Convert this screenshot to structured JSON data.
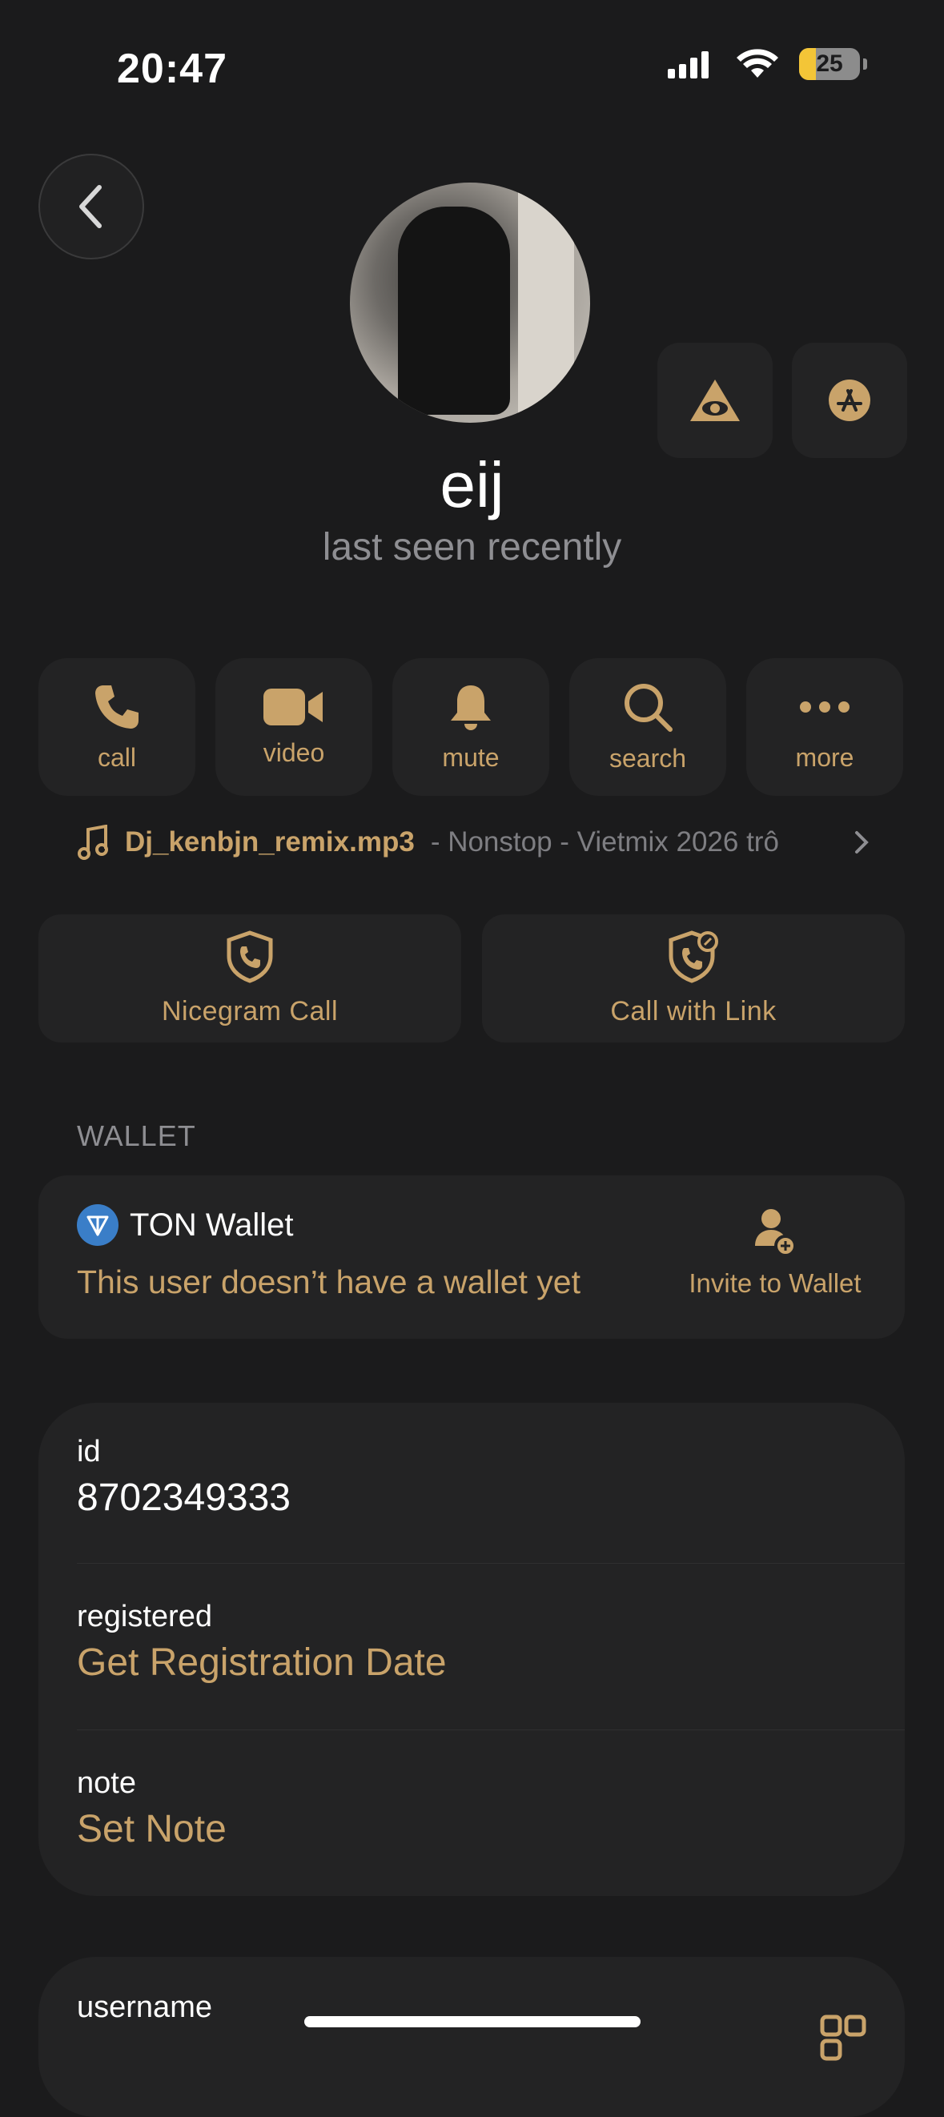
{
  "status_bar": {
    "time": "20:47",
    "battery": "25"
  },
  "profile": {
    "name": "eij",
    "status": "last seen recently"
  },
  "actions": [
    {
      "label": "call",
      "icon": "phone-icon"
    },
    {
      "label": "video",
      "icon": "video-camera-icon"
    },
    {
      "label": "mute",
      "icon": "bell-icon"
    },
    {
      "label": "search",
      "icon": "search-icon"
    },
    {
      "label": "more",
      "icon": "ellipsis-icon"
    }
  ],
  "music": {
    "song": "Dj_kenbjn_remix.mp3",
    "rest": " - Nonstop - Vietmix 2026 trô"
  },
  "calls": {
    "nicegram": "Nicegram Call",
    "link": "Call with Link"
  },
  "wallet": {
    "section": "WALLET",
    "title": "TON Wallet",
    "message": "This user doesn’t have a wallet yet",
    "invite": "Invite to Wallet"
  },
  "info": {
    "id_label": "id",
    "id_value": "8702349333",
    "registered_label": "registered",
    "registered_value": "Get Registration Date",
    "note_label": "note",
    "note_value": "Set Note"
  },
  "username": {
    "label": "username"
  },
  "colors": {
    "accent": "#c9a36a",
    "background": "#1b1b1c",
    "card": "#232324",
    "muted": "#8e8e92"
  }
}
